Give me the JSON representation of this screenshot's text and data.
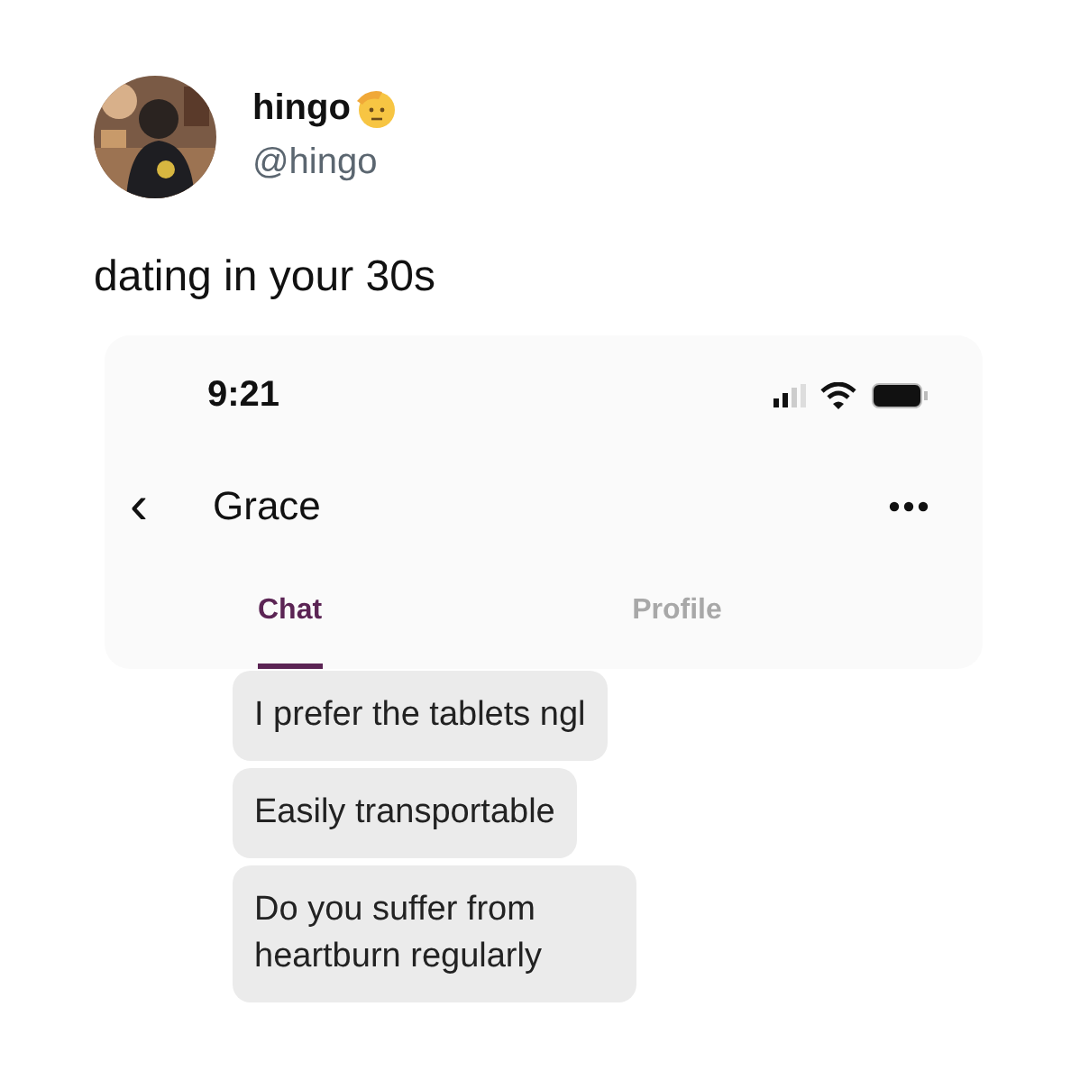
{
  "tweet": {
    "name": "hingo",
    "handle": "@hingo",
    "text": "dating in your 30s"
  },
  "phone": {
    "time": "9:21",
    "contact": "Grace",
    "back": "‹",
    "tabs": [
      {
        "label": "Chat",
        "selected": true
      },
      {
        "label": "Profile",
        "selected": false
      }
    ],
    "messages": [
      {
        "text": "I prefer the tablets ngl"
      },
      {
        "text": "Easily transportable"
      },
      {
        "text": "Do you suffer from heartburn regularly"
      }
    ]
  }
}
